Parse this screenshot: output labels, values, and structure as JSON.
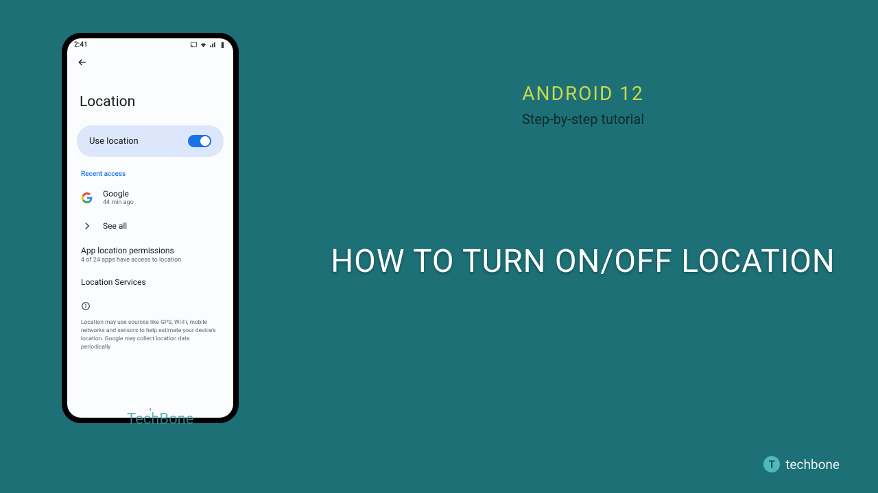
{
  "phone": {
    "status_time": "2:41",
    "page_title": "Location",
    "toggle_label": "Use location",
    "recent_access_label": "Recent access",
    "google_item": {
      "name": "Google",
      "meta": "44 min ago"
    },
    "see_all": "See all",
    "app_perm_title": "App location permissions",
    "app_perm_sub": "4 of 24 apps have access to location",
    "services_title": "Location Services",
    "info_text": "Location may use sources like GPS, Wi-Fi, mobile networks and sensors to help estimate your device's location. Google may collect location data periodically"
  },
  "slide": {
    "headline": "ANDROID 12",
    "subhead": "Step-by-step tutorial",
    "title": "HOW TO TURN ON/OFF LOCATION"
  },
  "watermark": "TechBone",
  "brand": {
    "badge": "T",
    "name": "techbone"
  }
}
